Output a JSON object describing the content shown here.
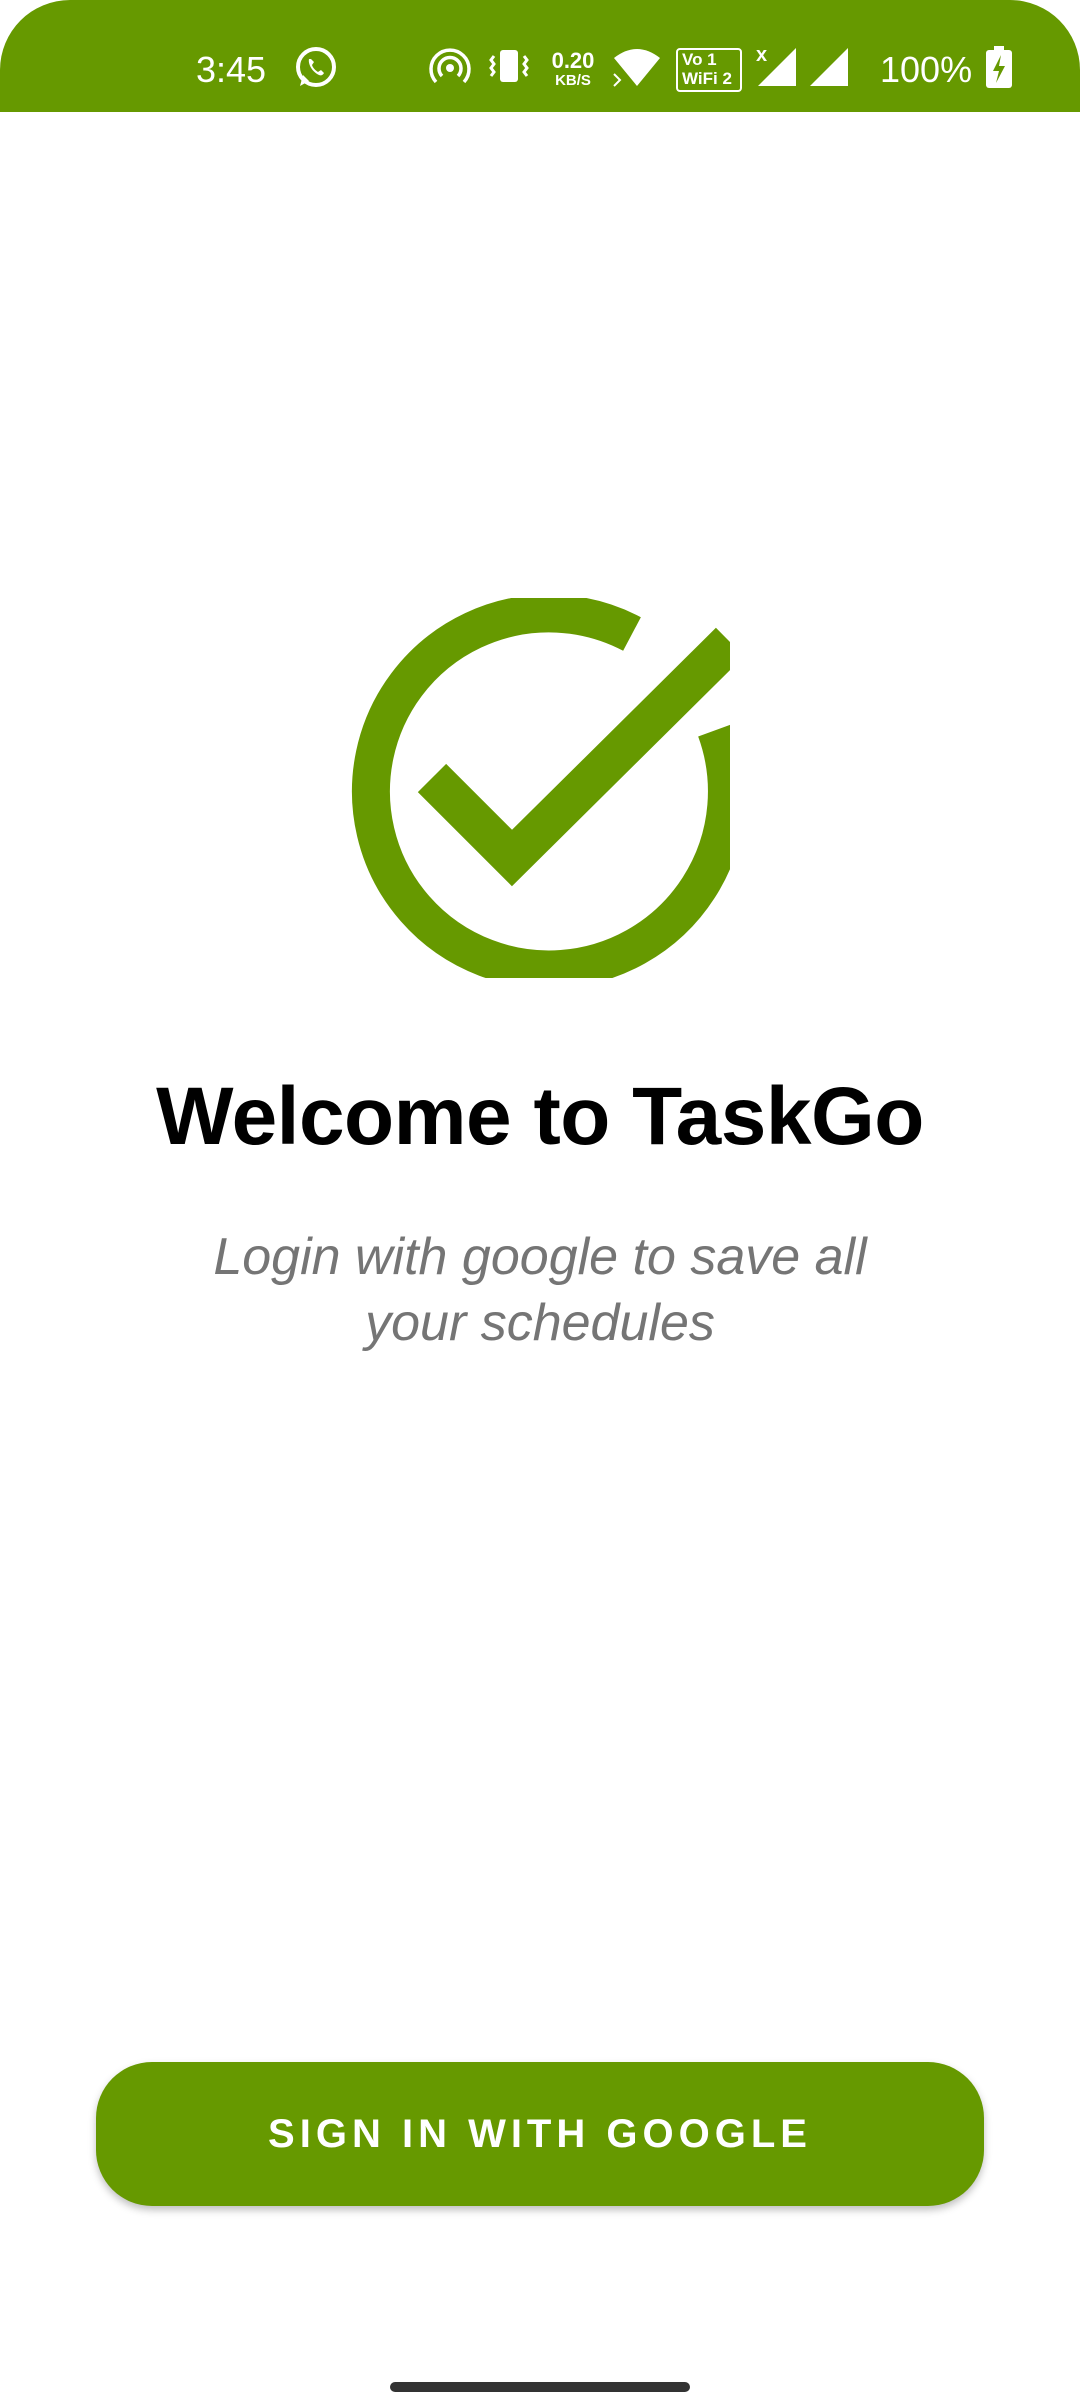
{
  "status_bar": {
    "time": "3:45",
    "data_rate_value": "0.20",
    "data_rate_unit": "KB/S",
    "vowifi_line1": "Vo 1",
    "vowifi_line2": "WiFi 2",
    "roaming_marker": "x",
    "battery_percent": "100%",
    "background_color": "#669900",
    "icons": [
      "whatsapp-icon",
      "hotspot-icon",
      "vibrate-icon",
      "wifi-icon",
      "signal-1-icon",
      "signal-2-icon",
      "battery-charging-icon"
    ]
  },
  "logo": {
    "icon": "check-circle-icon",
    "color": "#669900"
  },
  "welcome": {
    "title": "Welcome to TaskGo",
    "subtitle": "Login with google to save all your schedules"
  },
  "actions": {
    "signin_label": "SIGN IN WITH GOOGLE",
    "button_color": "#669900"
  }
}
